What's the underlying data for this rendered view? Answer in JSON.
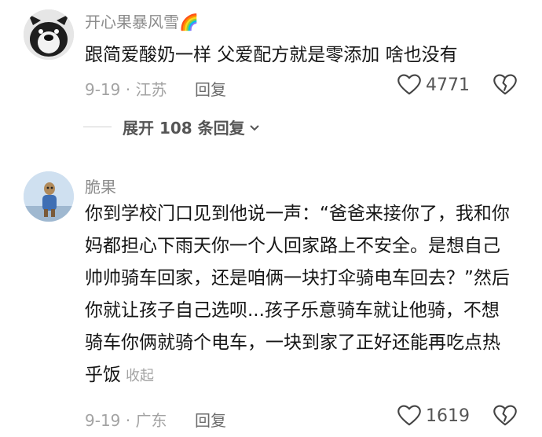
{
  "comments": [
    {
      "username": "开心果暴风雪🌈",
      "text": "跟简爱酸奶一样 父爱配方就是零添加 啥也没有",
      "date_location": "9-19 · 江苏",
      "reply_label": "回复",
      "likes": "4771",
      "expand_label": "展开 108 条回复"
    },
    {
      "username": "脆果",
      "text": "你到学校门口见到他说一声：“爸爸来接你了，我和你妈都担心下雨天你一个人回家路上不安全。是想自己帅帅骑车回家，还是咱俩一块打伞骑电车回去？”然后你就让孩子自己选呗...孩子乐意骑车就让他骑，不想骑车你俩就骑个电车，一块到家了正好还能再吃点热乎饭",
      "collapse_label": "收起",
      "date_location": "9-19 · 广东",
      "reply_label": "回复",
      "likes": "1619"
    }
  ]
}
